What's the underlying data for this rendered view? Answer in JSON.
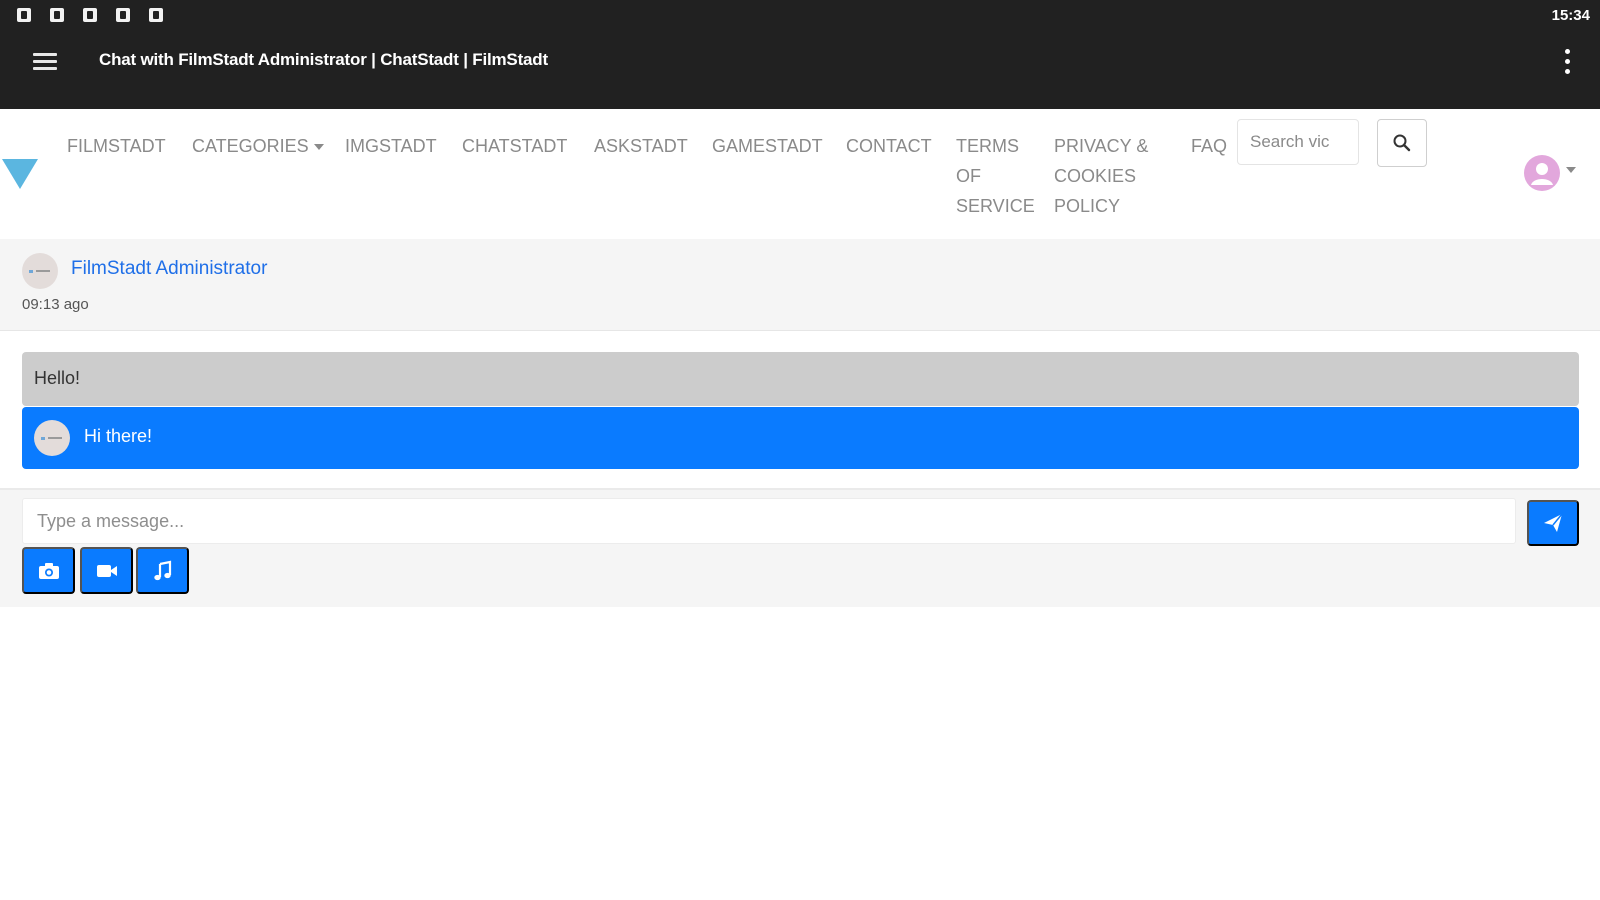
{
  "status_bar": {
    "notification_icons": [
      "notification-icon",
      "notification-icon",
      "notification-icon",
      "notification-icon",
      "notification-icon"
    ],
    "clock": "15:34"
  },
  "app_bar": {
    "title": "Chat with FilmStadt Administrator | ChatStadt | FilmStadt",
    "menu_icon": "hamburger-icon",
    "overflow_icon": "more-vertical-icon"
  },
  "navbar": {
    "items": [
      {
        "label": "FILMSTADT"
      },
      {
        "label": "CATEGORIES"
      },
      {
        "label": "IMGSTADT"
      },
      {
        "label": "CHATSTADT"
      },
      {
        "label": "ASKSTADT"
      },
      {
        "label": "GAMESTADT"
      },
      {
        "label": "CONTACT"
      },
      {
        "label": "TERMS OF SERVICE"
      },
      {
        "label": "PRIVACY & COOKIES POLICY"
      },
      {
        "label": "FAQ"
      }
    ],
    "search_placeholder": "Search vic",
    "search_icon": "search-icon",
    "user_icon": "user-avatar-icon",
    "brand_color": "#5bb6e0"
  },
  "chat": {
    "partner_name": "FilmStadt Administrator",
    "time": "09:13 ago",
    "messages": [
      {
        "text": "Hello!",
        "direction": "received"
      },
      {
        "text": "Hi there!",
        "direction": "sent"
      }
    ],
    "input_placeholder": "Type a message...",
    "accent_color": "#0a7bff"
  }
}
